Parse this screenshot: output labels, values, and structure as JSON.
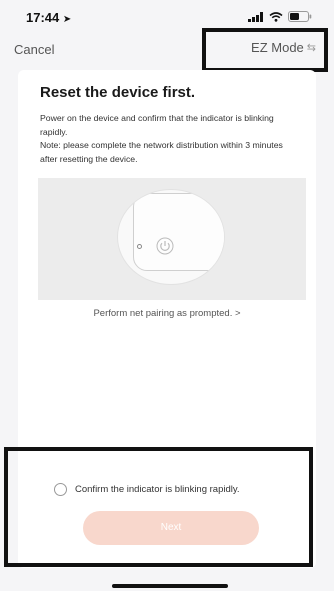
{
  "status_bar": {
    "time": "17:44",
    "location_icon": "location-arrow-icon",
    "signal_icon": "cellular-signal-icon",
    "wifi_icon": "wifi-icon",
    "battery_icon": "battery-icon"
  },
  "nav": {
    "cancel_label": "Cancel",
    "mode_label": "EZ Mode",
    "mode_icon": "switch-arrows-icon"
  },
  "content": {
    "title": "Reset the device first.",
    "description_line1": "Power on the device and confirm that the indicator is blinking rapidly.",
    "description_line2": "Note: please complete the network distribution within 3 minutes after resetting the device.",
    "pairing_link": "Perform net pairing as prompted. >",
    "confirm_label": "Confirm the indicator is blinking rapidly.",
    "next_label": "Next"
  },
  "colors": {
    "accent_disabled": "#f8d7cc",
    "background": "#f5f5f7",
    "card": "#ffffff"
  }
}
